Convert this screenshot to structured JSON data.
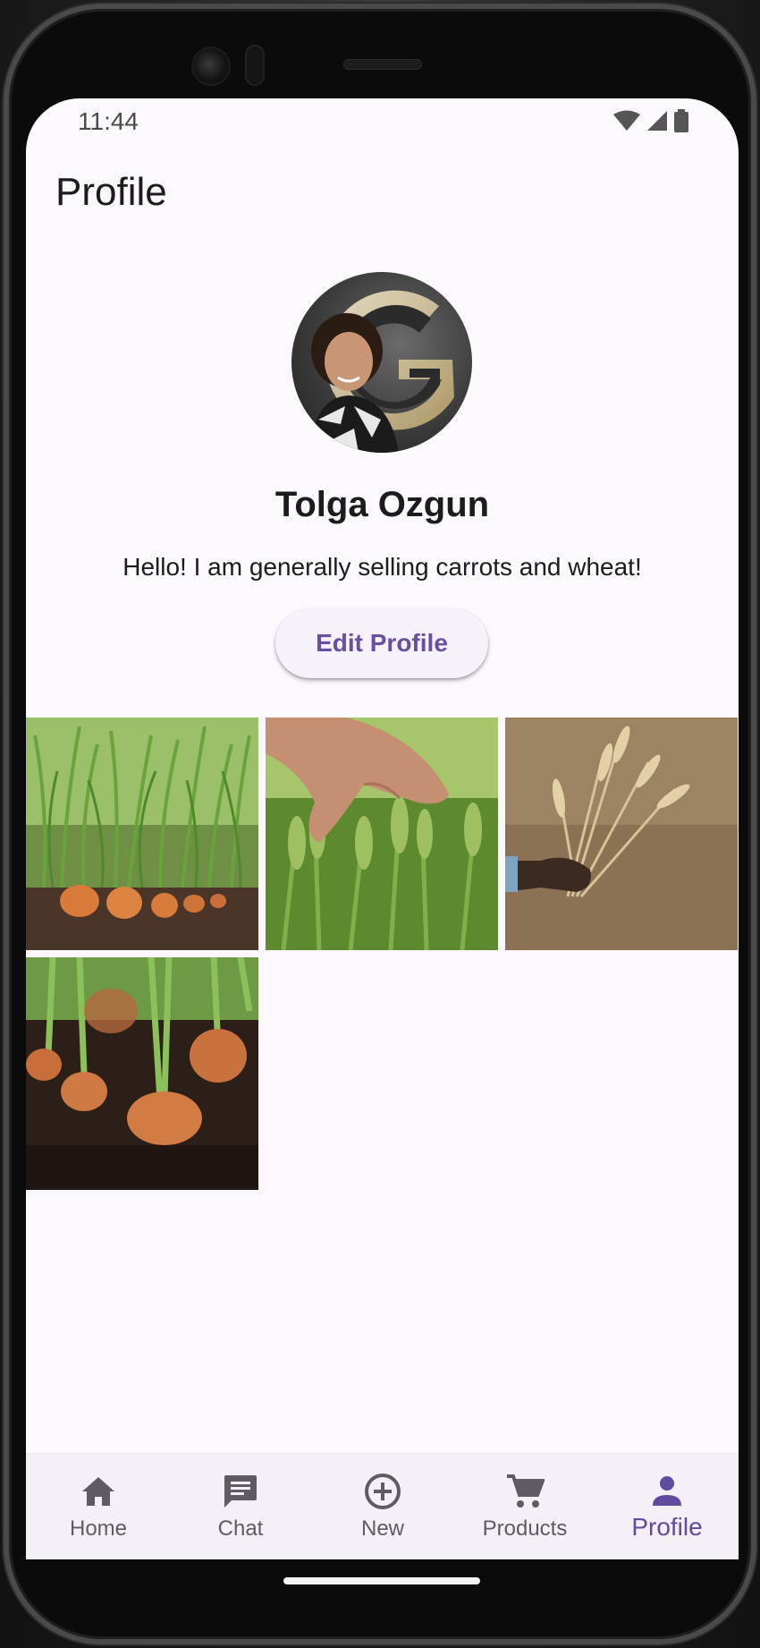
{
  "status_bar": {
    "time": "11:44",
    "icons": [
      "wifi-icon",
      "signal-icon",
      "battery-icon"
    ]
  },
  "app_bar": {
    "title": "Profile"
  },
  "profile": {
    "name": "Tolga Ozgun",
    "bio": "Hello! I am generally selling carrots and wheat!",
    "edit_button_label": "Edit Profile"
  },
  "gallery": {
    "images": [
      "carrots-field-photo",
      "hand-touching-wheat-photo",
      "hand-holding-wheat-photo",
      "carrots-in-soil-photo"
    ]
  },
  "bottom_nav": {
    "items": [
      {
        "label": "Home",
        "icon": "home-icon"
      },
      {
        "label": "Chat",
        "icon": "chat-icon"
      },
      {
        "label": "New",
        "icon": "add-circle-icon"
      },
      {
        "label": "Products",
        "icon": "cart-icon"
      },
      {
        "label": "Profile",
        "icon": "person-icon"
      }
    ],
    "active": "Profile"
  },
  "colors": {
    "accent": "#6750a4",
    "background": "#fdf8fd",
    "nav_background": "#f5eff7",
    "text": "#1c1b1f"
  }
}
